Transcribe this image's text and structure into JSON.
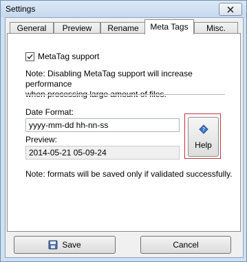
{
  "window": {
    "title": "Settings"
  },
  "tabs": [
    {
      "label": "General",
      "active": false
    },
    {
      "label": "Preview",
      "active": false
    },
    {
      "label": "Rename",
      "active": false
    },
    {
      "label": "Meta Tags",
      "active": true
    },
    {
      "label": "Misc.",
      "active": false
    }
  ],
  "meta_tags": {
    "checkbox_label": "MetaTag support",
    "checkbox_checked": true,
    "note_line1": "Note: Disabling MetaTag support will increase performance",
    "note_line2": "when processing large amount of files.",
    "date_format_label": "Date Format:",
    "date_format_value": "yyyy-mm-dd hh-nn-ss",
    "preview_label": "Preview:",
    "preview_value": "2014-05-21 05-09-24",
    "help_label": "Help",
    "footer_note": "Note: formats will be saved only if validated successfully."
  },
  "buttons": {
    "save_label": "Save",
    "cancel_label": "Cancel"
  },
  "colors": {
    "highlight_border": "#c4323b",
    "window_frame": "#cfe0f3"
  }
}
